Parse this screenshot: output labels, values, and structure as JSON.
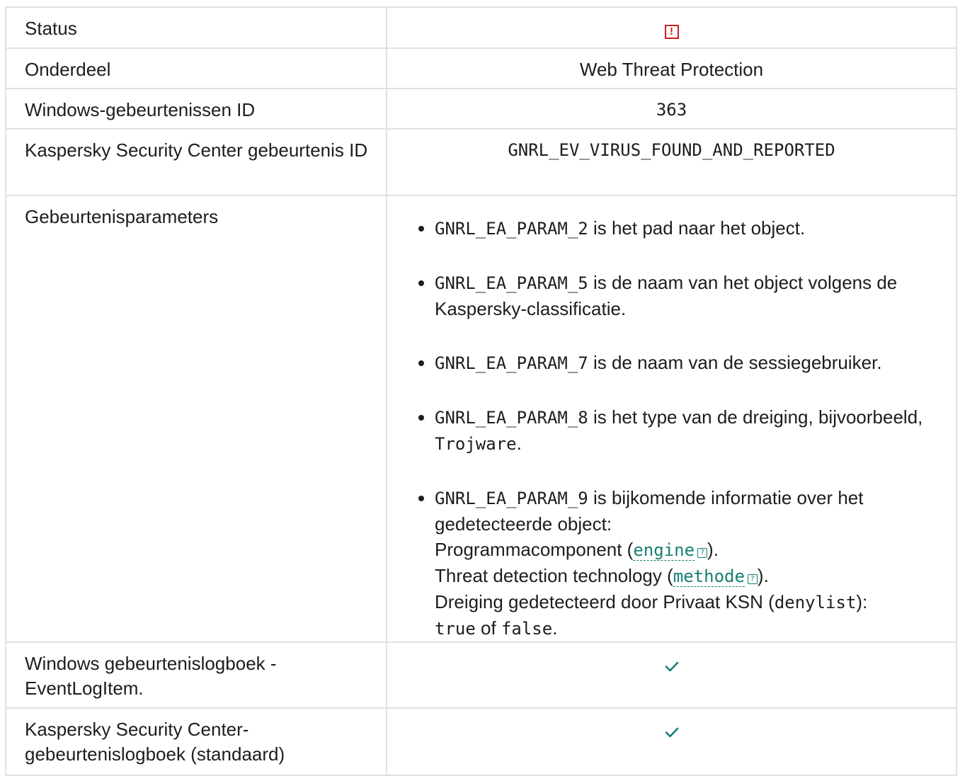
{
  "rows": {
    "status": {
      "label": "Status",
      "icon": "error-icon",
      "icon_color": "#d21e1e",
      "icon_glyph": "!"
    },
    "component": {
      "label": "Onderdeel",
      "value": "Web Threat Protection"
    },
    "windows_id": {
      "label": "Windows-gebeurtenissen ID",
      "value": "363"
    },
    "ksc_id": {
      "label": "Kaspersky Security Center gebeurtenis ID",
      "value": "GNRL_EV_VIRUS_FOUND_AND_REPORTED"
    },
    "params": {
      "label": "Gebeurtenisparameters",
      "items": [
        {
          "code": "GNRL_EA_PARAM_2",
          "text": " is het pad naar het object."
        },
        {
          "code": "GNRL_EA_PARAM_5",
          "text": " is de naam van het object volgens de Kaspersky-classificatie."
        },
        {
          "code": "GNRL_EA_PARAM_7",
          "text": " is de naam van de sessiegebruiker."
        },
        {
          "code": "GNRL_EA_PARAM_8",
          "text": " is het type van de dreiging, bijvoorbeeld, ",
          "example": "Trojware",
          "end": "."
        },
        {
          "code": "GNRL_EA_PARAM_9",
          "text": " is bijkomende informatie over het gedetecteerde object:",
          "line1_prefix": "Programmacomponent (",
          "line1_link": "engine",
          "line1_suffix": ").",
          "line2_prefix": "Threat detection technology (",
          "line2_link": "methode",
          "line2_suffix": ").",
          "line3_prefix": "Dreiging gedetecteerd door Privaat KSN (",
          "line3_code": "denylist",
          "line3_suffix": "):",
          "line4_true": "true",
          "line4_of": " of ",
          "line4_false": "false",
          "line4_end": "."
        }
      ]
    },
    "event_log": {
      "label": "Windows gebeurtenislogboek - EventLogItem.",
      "icon": "check-icon"
    },
    "ksc_log": {
      "label": "Kaspersky Security Center-gebeurtenislogboek (standaard)",
      "icon": "check-icon"
    }
  },
  "help_glyph": "?",
  "colors": {
    "accent": "#167f74",
    "error": "#d21e1e",
    "border": "#e0e0dc",
    "check": "#167f74"
  }
}
